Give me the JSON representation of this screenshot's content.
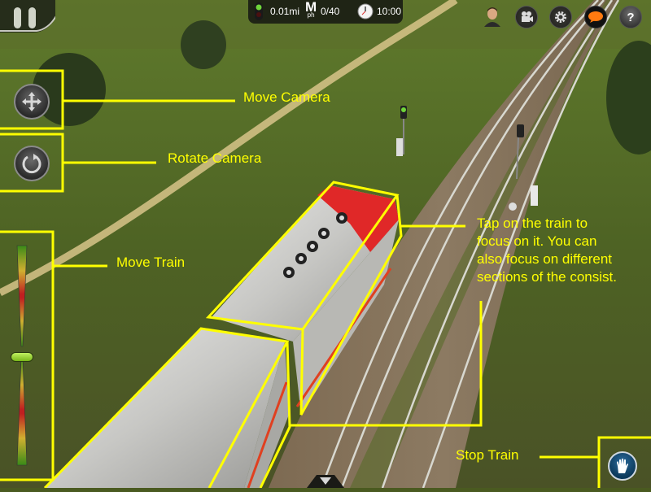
{
  "hud": {
    "distance": "0.01mi",
    "speed_unit_main": "M",
    "speed_unit_sub": "ph",
    "speed": "0/40",
    "time": "10:00",
    "signal_color": "#6fd63a"
  },
  "top_icons": [
    {
      "name": "driver-avatar",
      "icon": "avatar"
    },
    {
      "name": "camera",
      "icon": "movie-camera-icon"
    },
    {
      "name": "settings",
      "icon": "gear-icon"
    },
    {
      "name": "chat",
      "icon": "speech-bubble-icon",
      "color": "#ff7a10"
    },
    {
      "name": "help",
      "icon": "question-icon",
      "glyph": "?"
    }
  ],
  "annotations": {
    "move_camera": "Move Camera",
    "rotate_camera": "Rotate Camera",
    "move_train": "Move Train",
    "stop_train": "Stop Train",
    "tap_train_lines": [
      "Tap on the train to",
      "focus on it. You can",
      "also focus on different",
      "sections of the consist."
    ]
  },
  "throttle": {
    "position": 0.5
  },
  "colors": {
    "annotation": "#ffff00",
    "stop_button": "#0d3a5c",
    "throttle_knob": "#9ad62a"
  }
}
